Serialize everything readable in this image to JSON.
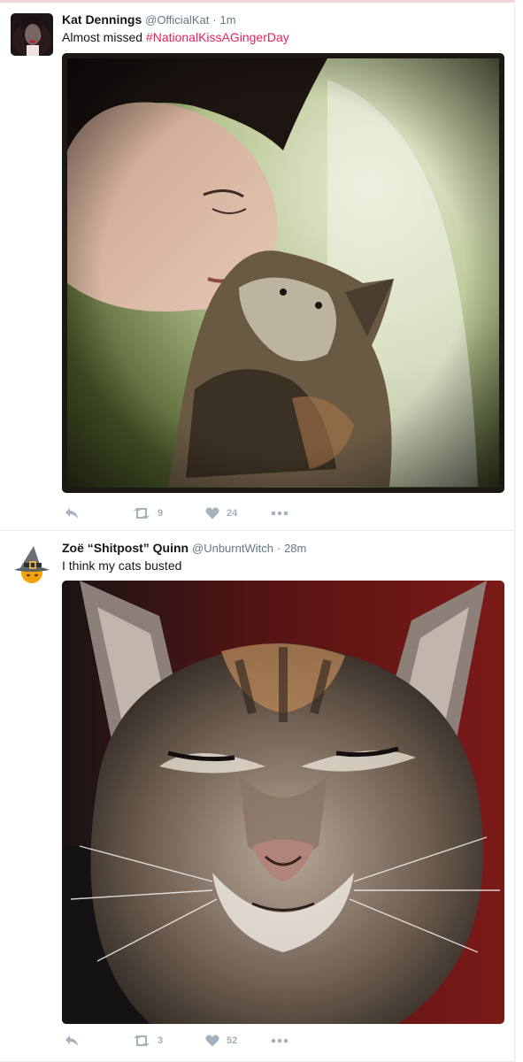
{
  "tweets": [
    {
      "fullname": "Kat Dennings",
      "username": "@OfficialKat",
      "separator": "·",
      "time": "1m",
      "text": "Almost missed ",
      "hashtag": "#NationalKissAGingerDay",
      "retweet_count": "9",
      "like_count": "24"
    },
    {
      "fullname": "Zoë “Shitpost” Quinn",
      "username": "@UnburntWitch",
      "separator": "·",
      "time": "28m",
      "text": "I think my cats busted",
      "retweet_count": "3",
      "like_count": "52"
    }
  ],
  "icons": {
    "reply": "reply-icon",
    "retweet": "retweet-icon",
    "like": "heart-icon",
    "more": "more-dots-icon"
  },
  "colors": {
    "hashtag": "#e0245e",
    "action_gray": "#a5b1bd",
    "name": "#14171a",
    "meta": "#657786"
  }
}
